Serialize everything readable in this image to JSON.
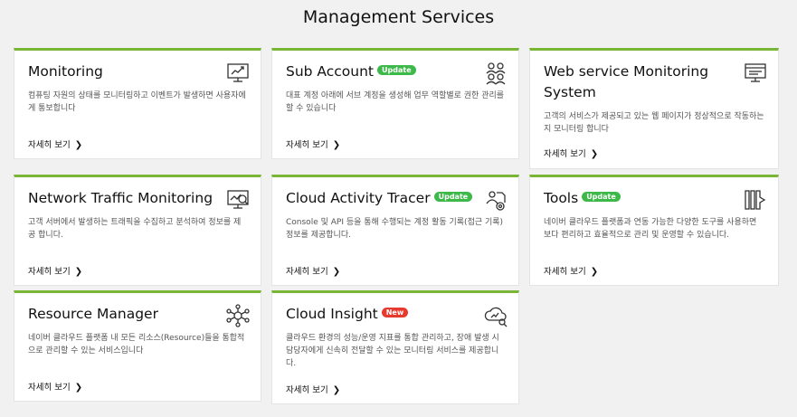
{
  "page": {
    "title": "Management Services"
  },
  "link_label": "자세히 보기",
  "colors": {
    "accent_border": "#7ab635",
    "update_badge": "#3db94a",
    "new_badge": "#e8392f"
  },
  "cards": [
    {
      "title": "Monitoring",
      "badge": "",
      "desc": "컴퓨팅 자원의 상태를 모니터링하고 이벤트가 발생하면 사용자에게 통보합니다",
      "icon": "monitor-chart-icon"
    },
    {
      "title": "Sub Account",
      "badge": "Update",
      "desc": "대표 계정 아래에 서브 계정을 생성해 업무 역할별로 권한 관리를 할 수 있습니다",
      "icon": "users-icon"
    },
    {
      "title": "Web service Monitoring System",
      "badge": "",
      "desc": "고객의 서비스가 제공되고 있는 웹 페이지가 정상적으로 작동하는지 모니터링 합니다",
      "icon": "web-page-icon"
    },
    {
      "title": "Network Traffic Monitoring",
      "badge": "",
      "desc": "고객 서버에서 발생하는 트래픽을 수집하고 분석하여 정보를 제공 합니다.",
      "icon": "network-traffic-icon"
    },
    {
      "title": "Cloud Activity Tracer",
      "badge": "Update",
      "desc": "Console 및 API 등을 통해 수행되는 계정 활동 기록(접근 기록) 정보를 제공합니다.",
      "icon": "activity-tracer-icon"
    },
    {
      "title": "Tools",
      "badge": "Update",
      "desc": "네이버 클라우드 플랫폼과 연동 가능한 다양한 도구를 사용하면 보다 편리하고 효율적으로 관리 및 운영할 수 있습니다.",
      "icon": "tools-icon"
    },
    {
      "title": "Resource Manager",
      "badge": "",
      "desc": "네이버 클라우드 플랫폼 내 모든 리소스(Resource)들을 통합적으로 관리할 수 있는 서비스입니다",
      "icon": "resource-network-icon"
    },
    {
      "title": "Cloud Insight",
      "badge": "New",
      "desc": "클라우드 환경의 성능/운영 지표를 통합 관리하고, 장애 발생 시 담당자에게 신속히 전달할 수 있는 모니터링 서비스를 제공합니다.",
      "icon": "cloud-insight-icon"
    }
  ]
}
